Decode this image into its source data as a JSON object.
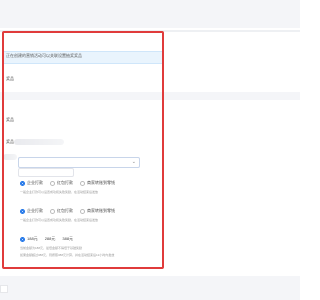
{
  "notice": {
    "text": "正在创建的营销活动可以关联设置抽奖奖品"
  },
  "labels": {
    "section_a": "奖品",
    "section_b": "奖品",
    "field_1": "奖品",
    "field_2": "奖品"
  },
  "reward_type_group_1": {
    "options": [
      "企业打款",
      "红包打款",
      "商家转账到零钱"
    ],
    "selected": "企业打款",
    "note": "一般企业打款可以设置成功和失败奖励，在活动结束后发放"
  },
  "reward_type_group_2": {
    "options": [
      "企业打款",
      "红包打款",
      "商家转账到零钱"
    ],
    "selected": "企业打款",
    "note": "一般企业打款可以设置成功和失败奖励，在活动结束后发放"
  },
  "amount_group": {
    "options": [
      "188元",
      "288元",
      "388元"
    ],
    "selected": "188元",
    "note_1": "当前金额为188元，最低金额不得低于基础奖励",
    "note_2": "如果金额超过388元，则按照388元计算，并在活动结束后12小时内发放"
  },
  "colors": {
    "frame": "#e03b3b",
    "accent": "#1e74e8",
    "notice_bg": "#e9f4fd"
  }
}
